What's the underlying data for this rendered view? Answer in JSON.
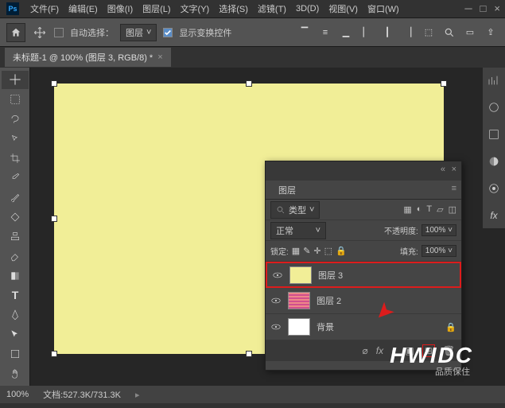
{
  "menubar": {
    "items": [
      "文件(F)",
      "编辑(E)",
      "图像(I)",
      "图层(L)",
      "文字(Y)",
      "选择(S)",
      "滤镜(T)",
      "3D(D)",
      "视图(V)",
      "窗口(W)"
    ]
  },
  "optionsbar": {
    "auto_select_label": "自动选择：",
    "auto_select_dropdown": "图层",
    "show_transform_label": "显示变换控件"
  },
  "document": {
    "tab_title": "未标题-1 @ 100% (图层 3, RGB/8) *",
    "zoom": "100%",
    "doc_info_label": "文档:",
    "doc_info": "527.3K/731.3K"
  },
  "layers_panel": {
    "title": "图层",
    "kind_label": "类型",
    "blend_mode": "正常",
    "opacity_label": "不透明度:",
    "opacity_value": "100%",
    "lock_label": "锁定:",
    "fill_label": "填充:",
    "fill_value": "100%",
    "layers": [
      {
        "name": "图层 3",
        "visible": true,
        "selected": true,
        "thumb_color": "#f1ee97"
      },
      {
        "name": "图层 2",
        "visible": true,
        "selected": false,
        "thumb_color": "#d14f8e"
      },
      {
        "name": "背景",
        "visible": true,
        "selected": false,
        "thumb_color": "#ffffff",
        "locked": true
      }
    ]
  },
  "watermark": {
    "text": "HWIDC",
    "sub": "品质保住"
  }
}
